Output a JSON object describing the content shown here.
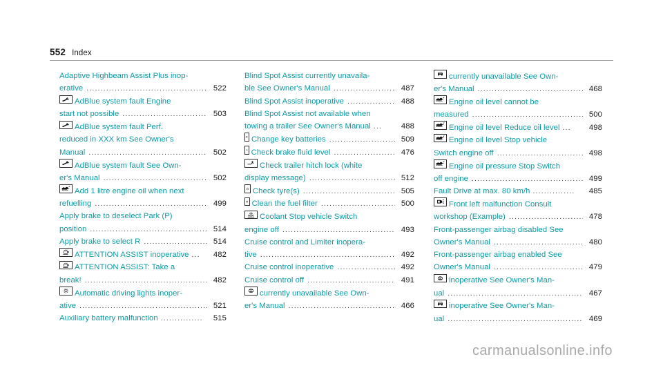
{
  "header": {
    "page_number": "552",
    "section": "Index"
  },
  "watermark": "carmanualsonline.info",
  "colors": {
    "entry_text": "#0d9aa3",
    "page_number": "#1a1a1a",
    "leader_dots": "#3a3a3a",
    "rule": "#9a9a9a",
    "watermark": "#a9a9a9"
  },
  "columns": [
    {
      "id": "column-1",
      "entries": [
        {
          "icon": null,
          "lines": [
            {
              "text": "Adaptive Highbeam Assist Plus inop-"
            },
            {
              "text": "erative",
              "leader": true,
              "page": "522"
            }
          ]
        },
        {
          "icon": "wrench-icon",
          "lines": [
            {
              "text": "AdBlue system fault Engine"
            },
            {
              "text": "start not possible",
              "leader": true,
              "page": "503"
            }
          ]
        },
        {
          "icon": "wrench-icon",
          "lines": [
            {
              "text": "AdBlue system fault Perf."
            },
            {
              "text": "reduced in XXX km See Owner's"
            },
            {
              "text": "Manual",
              "leader": true,
              "page": "502"
            }
          ]
        },
        {
          "icon": "wrench-icon",
          "lines": [
            {
              "text": "AdBlue system fault See Own-"
            },
            {
              "text": "er's Manual",
              "leader": true,
              "page": "502"
            }
          ]
        },
        {
          "icon": "oil-can-icon",
          "lines": [
            {
              "text": "Add 1 litre engine oil when next"
            },
            {
              "text": "refuelling",
              "leader": true,
              "page": "499"
            }
          ]
        },
        {
          "icon": null,
          "lines": [
            {
              "text": "Apply brake to deselect Park (P)"
            },
            {
              "text": "position",
              "leader": true,
              "page": "514"
            }
          ]
        },
        {
          "icon": null,
          "lines": [
            {
              "text": "Apply brake to select R",
              "leader": true,
              "page": "514"
            }
          ]
        },
        {
          "icon": "coffee-cup-icon",
          "lines": [
            {
              "text": "ATTENTION ASSIST inoperative",
              "ellipsis": "...",
              "page": "482"
            }
          ]
        },
        {
          "icon": "coffee-cup-icon",
          "lines": [
            {
              "text": "ATTENTION ASSIST: Take a"
            },
            {
              "text": "break!",
              "leader": true,
              "page": "482"
            }
          ]
        },
        {
          "icon": "sun-lamp-icon",
          "lines": [
            {
              "text": "Automatic driving lights inoper-"
            },
            {
              "text": "ative",
              "leader": true,
              "page": "521"
            }
          ]
        },
        {
          "icon": null,
          "lines": [
            {
              "text": "Auxiliary battery malfunction",
              "ellipsis": "...............",
              "page": "515"
            }
          ]
        }
      ]
    },
    {
      "id": "column-2",
      "entries": [
        {
          "icon": null,
          "lines": [
            {
              "text": "Blind Spot Assist currently unavaila-"
            },
            {
              "text": "ble See Owner's Manual",
              "leader": true,
              "page": "487"
            }
          ]
        },
        {
          "icon": null,
          "lines": [
            {
              "text": "Blind Spot Assist inoperative",
              "leader": true,
              "page": "488"
            }
          ]
        },
        {
          "icon": null,
          "lines": [
            {
              "text": "Blind Spot Assist not available when"
            },
            {
              "text": "towing a trailer See Owner's Manual",
              "ellipsis": "...",
              "page": "488"
            }
          ]
        },
        {
          "icon": "key-icon",
          "lines": [
            {
              "text": "Change key batteries",
              "leader": true,
              "page": "509"
            }
          ]
        },
        {
          "icon": "brake-fluid-icon",
          "lines": [
            {
              "text": "Check brake fluid level",
              "leader": true,
              "page": "476"
            }
          ]
        },
        {
          "icon": "trailer-hitch-icon",
          "lines": [
            {
              "text": "Check trailer hitch lock   (white"
            },
            {
              "text": "display message)",
              "leader": true,
              "page": "512"
            }
          ]
        },
        {
          "icon": "tyre-pressure-icon",
          "lines": [
            {
              "text": "Check tyre(s)",
              "leader": true,
              "page": "505"
            }
          ]
        },
        {
          "icon": "fuel-filter-icon",
          "lines": [
            {
              "text": "Clean the fuel filter",
              "leader": true,
              "page": "500"
            }
          ]
        },
        {
          "icon": "coolant-icon",
          "lines": [
            {
              "text": "Coolant Stop vehicle Switch"
            },
            {
              "text": "engine off",
              "leader": true,
              "page": "493"
            }
          ]
        },
        {
          "icon": null,
          "lines": [
            {
              "text": "Cruise control and Limiter inopera-"
            },
            {
              "text": "tive",
              "leader": true,
              "page": "492"
            }
          ]
        },
        {
          "icon": null,
          "lines": [
            {
              "text": "Cruise control inoperative",
              "leader": true,
              "page": "492"
            }
          ]
        },
        {
          "icon": null,
          "lines": [
            {
              "text": "Cruise control off",
              "leader": true,
              "page": "491"
            }
          ]
        },
        {
          "icon": "esp-icon",
          "lines": [
            {
              "text": "currently unavailable See Own-"
            },
            {
              "text": "er's Manual",
              "leader": true,
              "page": "466"
            }
          ]
        }
      ]
    },
    {
      "id": "column-3",
      "entries": [
        {
          "icon": "car-sensor-icon",
          "lines": [
            {
              "text": "currently unavailable See Own-"
            },
            {
              "text": "er's Manual",
              "leader": true,
              "page": "468"
            }
          ]
        },
        {
          "icon": "oil-can-icon",
          "lines": [
            {
              "text": "Engine oil level cannot be"
            },
            {
              "text": "measured",
              "leader": true,
              "page": "500"
            }
          ]
        },
        {
          "icon": "oil-can-icon",
          "lines": [
            {
              "text": "Engine oil level Reduce oil level",
              "ellipsis": "...",
              "page": "498"
            }
          ]
        },
        {
          "icon": "oil-can-icon",
          "lines": [
            {
              "text": "Engine oil level Stop vehicle"
            },
            {
              "text": "Switch engine off",
              "leader": true,
              "page": "498"
            }
          ]
        },
        {
          "icon": "oil-can-icon",
          "lines": [
            {
              "text": "Engine oil pressure Stop Switch"
            },
            {
              "text": "off engine",
              "leader": true,
              "page": "499"
            }
          ]
        },
        {
          "icon": null,
          "lines": [
            {
              "text": "Fault Drive at max. 80 km/h",
              "ellipsis": "...............",
              "page": "485"
            }
          ]
        },
        {
          "icon": "lamp-failure-icon",
          "lines": [
            {
              "text": "Front left malfunction Consult"
            },
            {
              "text": "workshop (Example)",
              "leader": true,
              "page": "478"
            }
          ]
        },
        {
          "icon": null,
          "lines": [
            {
              "text": "Front-passenger airbag disabled See"
            },
            {
              "text": "Owner's Manual",
              "leader": true,
              "page": "480"
            }
          ]
        },
        {
          "icon": null,
          "lines": [
            {
              "text": "Front-passenger airbag enabled See"
            },
            {
              "text": "Owner's Manual",
              "leader": true,
              "page": "479"
            }
          ]
        },
        {
          "icon": "esp-icon",
          "lines": [
            {
              "text": "inoperative See Owner's Man-"
            },
            {
              "text": "ual",
              "leader": true,
              "page": "467"
            }
          ]
        },
        {
          "icon": "car-sensor-icon",
          "lines": [
            {
              "text": "inoperative See Owner's Man-"
            },
            {
              "text": "ual",
              "leader": true,
              "page": "469"
            }
          ]
        }
      ]
    }
  ]
}
